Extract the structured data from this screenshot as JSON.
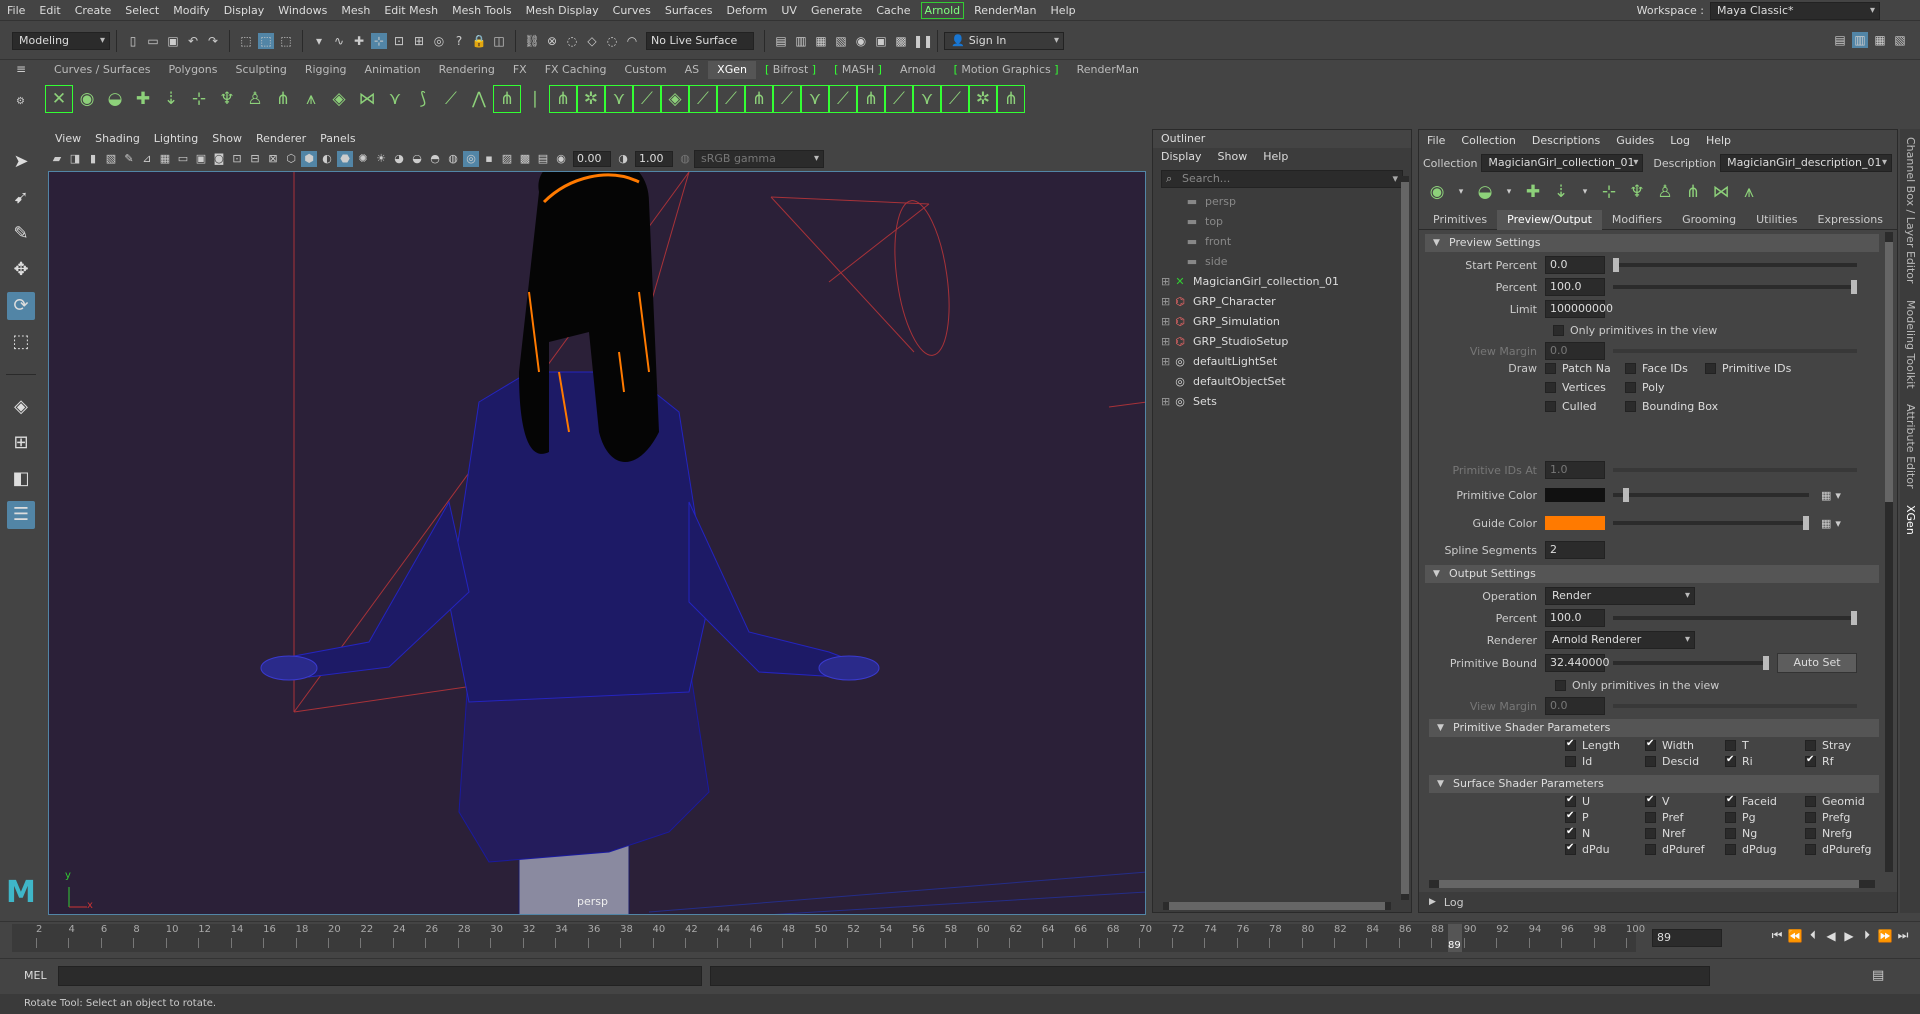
{
  "menubar": {
    "items": [
      "File",
      "Edit",
      "Create",
      "Select",
      "Modify",
      "Display",
      "Windows",
      "Mesh",
      "Edit Mesh",
      "Mesh Tools",
      "Mesh Display",
      "Curves",
      "Surfaces",
      "Deform",
      "UV",
      "Generate",
      "Cache"
    ],
    "highlight": "Arnold",
    "items_after": [
      "RenderMan",
      "Help"
    ],
    "workspace_label": "Workspace :",
    "workspace_value": "Maya Classic*"
  },
  "statusline": {
    "mode": "Modeling",
    "live_surface": "No Live Surface",
    "sign_in": "Sign In"
  },
  "shelf": {
    "tabs": [
      {
        "label": "Curves / Surfaces",
        "hl": false
      },
      {
        "label": "Polygons",
        "hl": false
      },
      {
        "label": "Sculpting",
        "hl": false
      },
      {
        "label": "Rigging",
        "hl": false
      },
      {
        "label": "Animation",
        "hl": false
      },
      {
        "label": "Rendering",
        "hl": false
      },
      {
        "label": "FX",
        "hl": false
      },
      {
        "label": "FX Caching",
        "hl": false
      },
      {
        "label": "Custom",
        "hl": false
      },
      {
        "label": "AS",
        "hl": false
      },
      {
        "label": "XGen",
        "hl": false,
        "active": true
      },
      {
        "label": "Bifrost",
        "hl": true
      },
      {
        "label": "MASH",
        "hl": true
      },
      {
        "label": "Arnold",
        "hl": false
      },
      {
        "label": "Motion Graphics",
        "hl": true
      },
      {
        "label": "RenderMan",
        "hl": false
      }
    ]
  },
  "viewport": {
    "menu": [
      "View",
      "Shading",
      "Lighting",
      "Show",
      "Renderer",
      "Panels"
    ],
    "exposure": "0.00",
    "gamma": "1.00",
    "color_space": "sRGB gamma",
    "camera_label": "persp",
    "axis_y": "y",
    "axis_x": "x"
  },
  "outliner": {
    "title": "Outliner",
    "menu": [
      "Display",
      "Show",
      "Help"
    ],
    "search_placeholder": "Search...",
    "items": [
      {
        "label": "persp",
        "icon": "camera-icon",
        "dim": true,
        "exp": ""
      },
      {
        "label": "top",
        "icon": "camera-icon",
        "dim": true,
        "exp": ""
      },
      {
        "label": "front",
        "icon": "camera-icon",
        "dim": true,
        "exp": ""
      },
      {
        "label": "side",
        "icon": "camera-icon",
        "dim": true,
        "exp": ""
      },
      {
        "label": "MagicianGirl_collection_01",
        "icon": "xgen-collection-icon",
        "dim": false,
        "exp": "⊞"
      },
      {
        "label": "GRP_Character",
        "icon": "group-icon",
        "dim": false,
        "exp": "⊞"
      },
      {
        "label": "GRP_Simulation",
        "icon": "group-icon",
        "dim": false,
        "exp": "⊞"
      },
      {
        "label": "GRP_StudioSetup",
        "icon": "group-icon",
        "dim": false,
        "exp": "⊞"
      },
      {
        "label": "defaultLightSet",
        "icon": "set-icon",
        "dim": false,
        "exp": "⊞"
      },
      {
        "label": "defaultObjectSet",
        "icon": "set-icon",
        "dim": false,
        "exp": ""
      },
      {
        "label": "Sets",
        "icon": "set-icon",
        "dim": false,
        "exp": "⊞"
      }
    ]
  },
  "xgen": {
    "menu": [
      "File",
      "Collection",
      "Descriptions",
      "Guides",
      "Log",
      "Help"
    ],
    "collection_label": "Collection",
    "collection_value": "MagicianGirl_collection_01",
    "description_label": "Description",
    "description_value": "MagicianGirl_description_01",
    "tabs": [
      "Primitives",
      "Preview/Output",
      "Modifiers",
      "Grooming",
      "Utilities",
      "Expressions"
    ],
    "active_tab": "Preview/Output",
    "preview_settings": {
      "title": "Preview Settings",
      "start_percent_label": "Start Percent",
      "start_percent": "0.0",
      "percent_label": "Percent",
      "percent": "100.0",
      "limit_label": "Limit",
      "limit": "100000000",
      "only_primitives": "Only primitives in the view",
      "view_margin_label": "View Margin",
      "view_margin": "0.0",
      "draw_label": "Draw",
      "draw_options": [
        {
          "label": "Patch Na",
          "on": false
        },
        {
          "label": "Face IDs",
          "on": false
        },
        {
          "label": "Primitive IDs",
          "on": false
        },
        {
          "label": "Vertices",
          "on": false
        },
        {
          "label": "Poly",
          "on": false
        },
        {
          "label": "Culled",
          "on": false
        },
        {
          "label": "Bounding Box",
          "on": false
        }
      ],
      "primitive_ids_at_label": "Primitive IDs At",
      "primitive_ids_at": "1.0",
      "primitive_color_label": "Primitive Color",
      "primitive_color": "#111111",
      "guide_color_label": "Guide Color",
      "guide_color": "#ff7a00",
      "spline_segments_label": "Spline Segments",
      "spline_segments": "2"
    },
    "output_settings": {
      "title": "Output Settings",
      "operation_label": "Operation",
      "operation": "Render",
      "percent_label": "Percent",
      "percent": "100.0",
      "renderer_label": "Renderer",
      "renderer": "Arnold Renderer",
      "primitive_bound_label": "Primitive Bound",
      "primitive_bound": "32.440000",
      "auto_set": "Auto Set",
      "only_primitives": "Only primitives in the view",
      "view_margin_label": "View Margin",
      "view_margin": "0.0"
    },
    "primitive_shader": {
      "title": "Primitive Shader Parameters",
      "params": [
        {
          "label": "Length",
          "on": true
        },
        {
          "label": "Width",
          "on": true
        },
        {
          "label": "T",
          "on": false
        },
        {
          "label": "Stray",
          "on": false
        },
        {
          "label": "Id",
          "on": false
        },
        {
          "label": "Descid",
          "on": false
        },
        {
          "label": "Ri",
          "on": true
        },
        {
          "label": "Rf",
          "on": true
        }
      ]
    },
    "surface_shader": {
      "title": "Surface Shader Parameters",
      "params": [
        {
          "label": "U",
          "on": true
        },
        {
          "label": "V",
          "on": true
        },
        {
          "label": "Faceid",
          "on": true
        },
        {
          "label": "Geomid",
          "on": false
        },
        {
          "label": "P",
          "on": true
        },
        {
          "label": "Pref",
          "on": false
        },
        {
          "label": "Pg",
          "on": false
        },
        {
          "label": "Prefg",
          "on": false
        },
        {
          "label": "N",
          "on": true
        },
        {
          "label": "Nref",
          "on": false
        },
        {
          "label": "Ng",
          "on": false
        },
        {
          "label": "Nrefg",
          "on": false
        },
        {
          "label": "dPdu",
          "on": true
        },
        {
          "label": "dPduref",
          "on": false
        },
        {
          "label": "dPdug",
          "on": false
        },
        {
          "label": "dPdurefg",
          "on": false
        }
      ]
    },
    "log_title": "Log"
  },
  "sidetabs": [
    "Channel Box / Layer Editor",
    "Modeling Toolkit",
    "Attribute Editor",
    "XGen"
  ],
  "timeline": {
    "ticks": [
      "2",
      "4",
      "6",
      "8",
      "10",
      "12",
      "14",
      "16",
      "18",
      "20",
      "22",
      "24",
      "26",
      "28",
      "30",
      "32",
      "34",
      "36",
      "38",
      "40",
      "42",
      "44",
      "46",
      "48",
      "50",
      "52",
      "54",
      "56",
      "58",
      "60",
      "62",
      "64",
      "66",
      "68",
      "70",
      "72",
      "74",
      "76",
      "78",
      "80",
      "82",
      "84",
      "86",
      "88",
      "90",
      "92",
      "94",
      "96",
      "98",
      "100"
    ],
    "current_frame": "89"
  },
  "cmdline": {
    "label": "MEL"
  },
  "helpline": {
    "text": "Rotate Tool: Select an object to rotate."
  }
}
